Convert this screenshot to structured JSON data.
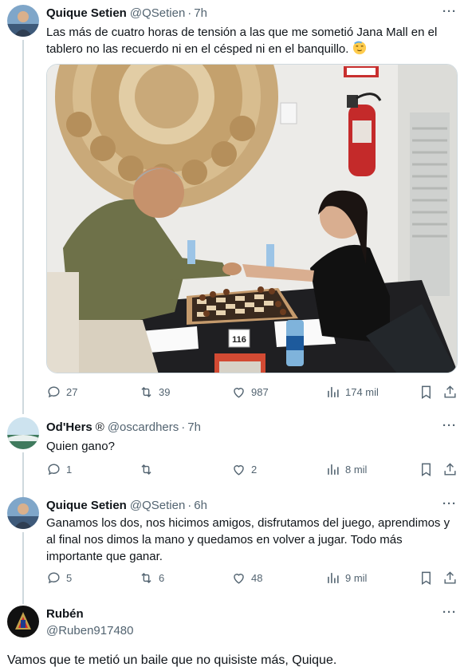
{
  "tweets": [
    {
      "name": "Quique Setien",
      "handle": "@QSetien",
      "time": "7h",
      "text": "Las más de cuatro horas de tensión a las que me sometió Jana Mall en el tablero no las recuerdo ni en el césped  ni en el banquillo.",
      "replies": "27",
      "retweets": "39",
      "likes": "987",
      "views": "174 mil",
      "image_label": "116"
    },
    {
      "name": "Od'Hers",
      "name_badge": "®",
      "handle": "@oscardhers",
      "time": "7h",
      "text": "Quien gano?",
      "replies": "1",
      "retweets": "",
      "likes": "2",
      "views": "8 mil"
    },
    {
      "name": "Quique Setien",
      "handle": "@QSetien",
      "time": "6h",
      "text": "Ganamos los dos, nos hicimos amigos, disfrutamos del juego, aprendimos y al final nos dimos la mano y quedamos en volver a jugar. Todo más importante que ganar.",
      "replies": "5",
      "retweets": "6",
      "likes": "48",
      "views": "9 mil"
    },
    {
      "name": "Rubén",
      "handle": "@Ruben917480",
      "text": "Vamos que te metió un baile que no quisiste más, Quique."
    }
  ],
  "dot": "·",
  "more": "···",
  "colors": {
    "secondary": "#536471",
    "line": "#cfd9de",
    "text": "#0f1419"
  }
}
